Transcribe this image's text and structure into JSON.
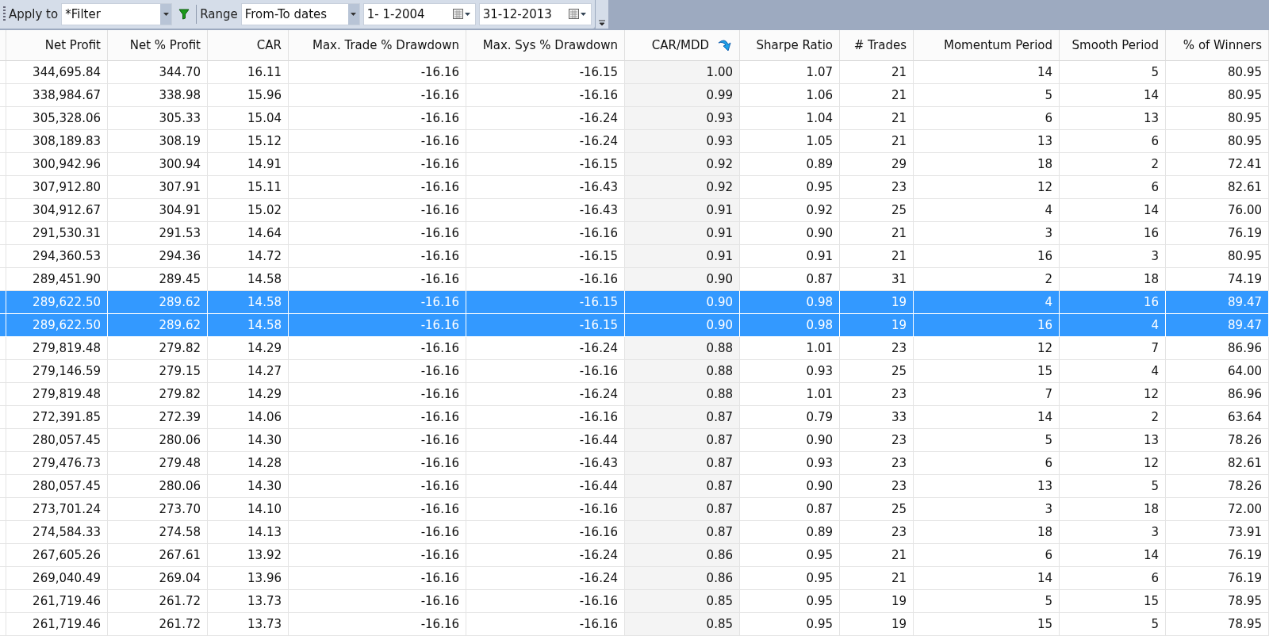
{
  "toolbar": {
    "apply_label": "Apply to",
    "apply_value": "*Filter",
    "range_label": "Range",
    "range_value": "From-To dates",
    "from_date": "1- 1-2004",
    "to_date": "31-12-2013"
  },
  "table": {
    "columns": [
      {
        "label": "Net Profit",
        "sorted": false
      },
      {
        "label": "Net % Profit",
        "sorted": false
      },
      {
        "label": "CAR",
        "sorted": false
      },
      {
        "label": "Max. Trade % Drawdown",
        "sorted": false
      },
      {
        "label": "Max. Sys % Drawdown",
        "sorted": false
      },
      {
        "label": "CAR/MDD",
        "sorted": true
      },
      {
        "label": "Sharpe Ratio",
        "sorted": false
      },
      {
        "label": "# Trades",
        "sorted": false
      },
      {
        "label": "Momentum Period",
        "sorted": false
      },
      {
        "label": "Smooth Period",
        "sorted": false
      },
      {
        "label": "% of Winners",
        "sorted": false
      }
    ],
    "rows": [
      {
        "selected": false,
        "cells": [
          "344,695.84",
          "344.70",
          "16.11",
          "-16.16",
          "-16.15",
          "1.00",
          "1.07",
          "21",
          "14",
          "5",
          "80.95"
        ]
      },
      {
        "selected": false,
        "cells": [
          "338,984.67",
          "338.98",
          "15.96",
          "-16.16",
          "-16.16",
          "0.99",
          "1.06",
          "21",
          "5",
          "14",
          "80.95"
        ]
      },
      {
        "selected": false,
        "cells": [
          "305,328.06",
          "305.33",
          "15.04",
          "-16.16",
          "-16.24",
          "0.93",
          "1.04",
          "21",
          "6",
          "13",
          "80.95"
        ]
      },
      {
        "selected": false,
        "cells": [
          "308,189.83",
          "308.19",
          "15.12",
          "-16.16",
          "-16.24",
          "0.93",
          "1.05",
          "21",
          "13",
          "6",
          "80.95"
        ]
      },
      {
        "selected": false,
        "cells": [
          "300,942.96",
          "300.94",
          "14.91",
          "-16.16",
          "-16.15",
          "0.92",
          "0.89",
          "29",
          "18",
          "2",
          "72.41"
        ]
      },
      {
        "selected": false,
        "cells": [
          "307,912.80",
          "307.91",
          "15.11",
          "-16.16",
          "-16.43",
          "0.92",
          "0.95",
          "23",
          "12",
          "6",
          "82.61"
        ]
      },
      {
        "selected": false,
        "cells": [
          "304,912.67",
          "304.91",
          "15.02",
          "-16.16",
          "-16.43",
          "0.91",
          "0.92",
          "25",
          "4",
          "14",
          "76.00"
        ]
      },
      {
        "selected": false,
        "cells": [
          "291,530.31",
          "291.53",
          "14.64",
          "-16.16",
          "-16.16",
          "0.91",
          "0.90",
          "21",
          "3",
          "16",
          "76.19"
        ]
      },
      {
        "selected": false,
        "cells": [
          "294,360.53",
          "294.36",
          "14.72",
          "-16.16",
          "-16.15",
          "0.91",
          "0.91",
          "21",
          "16",
          "3",
          "80.95"
        ]
      },
      {
        "selected": false,
        "cells": [
          "289,451.90",
          "289.45",
          "14.58",
          "-16.16",
          "-16.16",
          "0.90",
          "0.87",
          "31",
          "2",
          "18",
          "74.19"
        ]
      },
      {
        "selected": true,
        "cells": [
          "289,622.50",
          "289.62",
          "14.58",
          "-16.16",
          "-16.15",
          "0.90",
          "0.98",
          "19",
          "4",
          "16",
          "89.47"
        ]
      },
      {
        "selected": true,
        "cells": [
          "289,622.50",
          "289.62",
          "14.58",
          "-16.16",
          "-16.15",
          "0.90",
          "0.98",
          "19",
          "16",
          "4",
          "89.47"
        ]
      },
      {
        "selected": false,
        "cells": [
          "279,819.48",
          "279.82",
          "14.29",
          "-16.16",
          "-16.24",
          "0.88",
          "1.01",
          "23",
          "12",
          "7",
          "86.96"
        ]
      },
      {
        "selected": false,
        "cells": [
          "279,146.59",
          "279.15",
          "14.27",
          "-16.16",
          "-16.16",
          "0.88",
          "0.93",
          "25",
          "15",
          "4",
          "64.00"
        ]
      },
      {
        "selected": false,
        "cells": [
          "279,819.48",
          "279.82",
          "14.29",
          "-16.16",
          "-16.24",
          "0.88",
          "1.01",
          "23",
          "7",
          "12",
          "86.96"
        ]
      },
      {
        "selected": false,
        "cells": [
          "272,391.85",
          "272.39",
          "14.06",
          "-16.16",
          "-16.16",
          "0.87",
          "0.79",
          "33",
          "14",
          "2",
          "63.64"
        ]
      },
      {
        "selected": false,
        "cells": [
          "280,057.45",
          "280.06",
          "14.30",
          "-16.16",
          "-16.44",
          "0.87",
          "0.90",
          "23",
          "5",
          "13",
          "78.26"
        ]
      },
      {
        "selected": false,
        "cells": [
          "279,476.73",
          "279.48",
          "14.28",
          "-16.16",
          "-16.43",
          "0.87",
          "0.93",
          "23",
          "6",
          "12",
          "82.61"
        ]
      },
      {
        "selected": false,
        "cells": [
          "280,057.45",
          "280.06",
          "14.30",
          "-16.16",
          "-16.44",
          "0.87",
          "0.90",
          "23",
          "13",
          "5",
          "78.26"
        ]
      },
      {
        "selected": false,
        "cells": [
          "273,701.24",
          "273.70",
          "14.10",
          "-16.16",
          "-16.16",
          "0.87",
          "0.87",
          "25",
          "3",
          "18",
          "72.00"
        ]
      },
      {
        "selected": false,
        "cells": [
          "274,584.33",
          "274.58",
          "14.13",
          "-16.16",
          "-16.16",
          "0.87",
          "0.89",
          "23",
          "18",
          "3",
          "73.91"
        ]
      },
      {
        "selected": false,
        "cells": [
          "267,605.26",
          "267.61",
          "13.92",
          "-16.16",
          "-16.24",
          "0.86",
          "0.95",
          "21",
          "6",
          "14",
          "76.19"
        ]
      },
      {
        "selected": false,
        "cells": [
          "269,040.49",
          "269.04",
          "13.96",
          "-16.16",
          "-16.24",
          "0.86",
          "0.95",
          "21",
          "14",
          "6",
          "76.19"
        ]
      },
      {
        "selected": false,
        "cells": [
          "261,719.46",
          "261.72",
          "13.73",
          "-16.16",
          "-16.16",
          "0.85",
          "0.95",
          "19",
          "5",
          "15",
          "78.95"
        ]
      },
      {
        "selected": false,
        "cells": [
          "261,719.46",
          "261.72",
          "13.73",
          "-16.16",
          "-16.16",
          "0.85",
          "0.95",
          "19",
          "15",
          "5",
          "78.95"
        ]
      }
    ]
  }
}
